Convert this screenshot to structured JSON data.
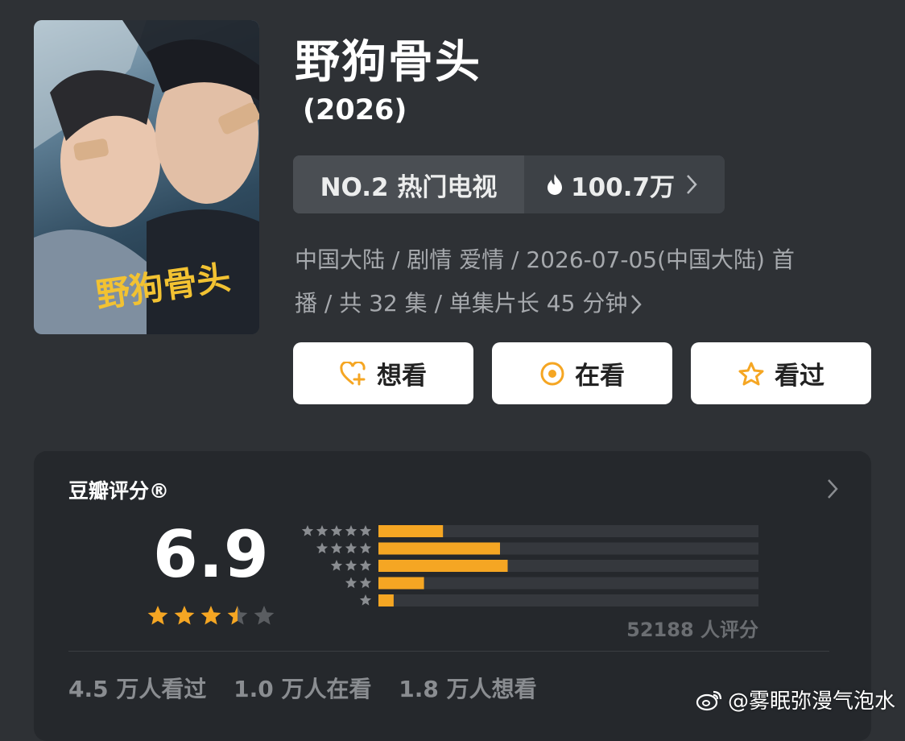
{
  "show": {
    "title": "野狗骨头",
    "year": "(2026)",
    "poster_logo_text": "野狗骨头"
  },
  "rank": {
    "label": "NO.2 热门电视",
    "heat": "100.7万"
  },
  "meta": {
    "line1": "中国大陆 / 剧情 爱情 / 2026-07-05(中国大陆) 首",
    "line2": "播 / 共 32 集 / 单集片长 45 分钟"
  },
  "actions": [
    {
      "label": "想看",
      "icon": "heart-plus-icon"
    },
    {
      "label": "在看",
      "icon": "target-circle-icon"
    },
    {
      "label": "看过",
      "icon": "star-outline-icon"
    }
  ],
  "rating": {
    "title": "豆瓣评分®",
    "score": "6.9",
    "stars": 3.5,
    "count_text": "52188 人评分",
    "distribution": [
      {
        "stars": 5,
        "fraction": 0.17
      },
      {
        "stars": 4,
        "fraction": 0.32
      },
      {
        "stars": 3,
        "fraction": 0.34
      },
      {
        "stars": 2,
        "fraction": 0.12
      },
      {
        "stars": 1,
        "fraction": 0.04
      }
    ],
    "stats": [
      "4.5 万人看过",
      "1.0 万人在看",
      "1.8 万人想看"
    ]
  },
  "watermark": "@雾眠弥漫气泡水",
  "colors": {
    "accent": "#f5a623",
    "background": "#2e3135",
    "card": "#25282c",
    "star_empty": "#5a5d61"
  }
}
